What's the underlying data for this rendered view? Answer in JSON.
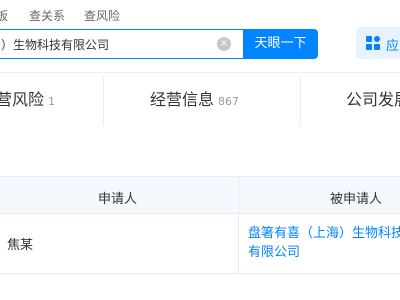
{
  "topnav": {
    "links": [
      "板",
      "查关系",
      "查风险"
    ]
  },
  "search": {
    "value": "）生物科技有限公司",
    "clear_icon": "×",
    "button_label": "天眼一下"
  },
  "app_button": {
    "label": "应",
    "icon": "grid-icon"
  },
  "tabs": [
    {
      "label": "营风险",
      "count": "1"
    },
    {
      "label": "经营信息",
      "count": "867"
    },
    {
      "label": "公司发展",
      "count": ""
    }
  ],
  "table": {
    "headers": [
      "申请人",
      "被申请人"
    ],
    "rows": [
      {
        "applicant": "焦某",
        "respondent": "盘箸有喜（上海）生物科技有限公司"
      }
    ]
  },
  "colors": {
    "accent": "#0084ff",
    "header_bg": "#f5f8fc"
  }
}
